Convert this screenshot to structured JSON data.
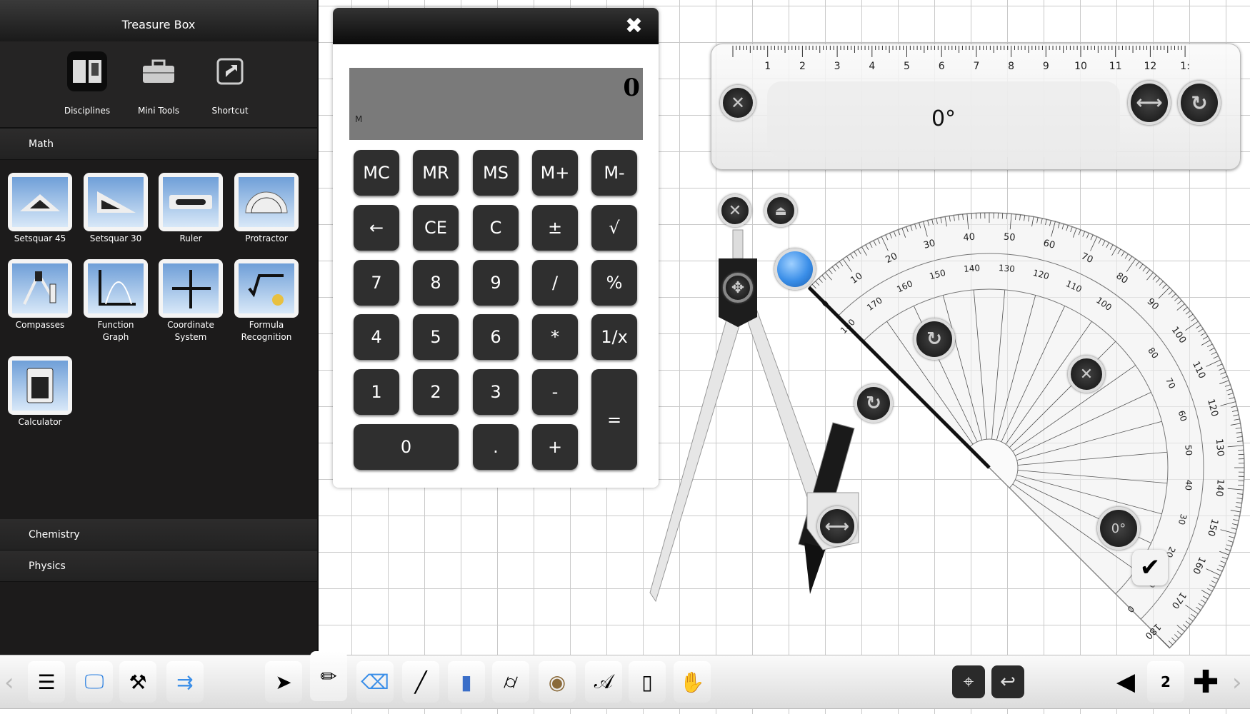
{
  "sidebar": {
    "title": "Treasure Box",
    "top_items": [
      {
        "label": "Disciplines",
        "icon": "book-icon"
      },
      {
        "label": "Mini Tools",
        "icon": "toolbox-icon"
      },
      {
        "label": "Shortcut",
        "icon": "shortcut-icon"
      }
    ],
    "sections": {
      "math": "Math",
      "chemistry": "Chemistry",
      "physics": "Physics"
    },
    "tools": [
      {
        "label": "Setsquar 45"
      },
      {
        "label": "Setsquar 30"
      },
      {
        "label": "Ruler"
      },
      {
        "label": "Protractor"
      },
      {
        "label": "Compasses"
      },
      {
        "label": "Function Graph"
      },
      {
        "label": "Coordinate System"
      },
      {
        "label": "Formula Recognition"
      },
      {
        "label": "Calculator"
      }
    ]
  },
  "calculator": {
    "display_value": "0",
    "memory_indicator": "M",
    "keys": [
      "MC",
      "MR",
      "MS",
      "M+",
      "M-",
      "←",
      "CE",
      "C",
      "±",
      "√",
      "7",
      "8",
      "9",
      "/",
      "%",
      "4",
      "5",
      "6",
      "*",
      "1/x",
      "1",
      "2",
      "3",
      "-",
      "=",
      "0",
      ".",
      "+"
    ]
  },
  "ruler": {
    "angle": "0°",
    "scale_labels": [
      "1",
      "2",
      "3",
      "4",
      "5",
      "6",
      "7",
      "8",
      "9",
      "10",
      "11",
      "12",
      "1:"
    ]
  },
  "protractor": {
    "angle": "0°",
    "outer_labels": [
      "0",
      "10",
      "20",
      "30",
      "40",
      "50",
      "60",
      "70",
      "80",
      "90",
      "100",
      "110",
      "120",
      "130",
      "140",
      "150",
      "160",
      "170",
      "180"
    ],
    "inner_labels": [
      "180",
      "170",
      "160",
      "150",
      "140",
      "130",
      "120",
      "110",
      "100",
      "80",
      "70",
      "60",
      "50",
      "40",
      "30",
      "20",
      "10",
      "0"
    ]
  },
  "toolbar": {
    "page_number": "2"
  },
  "colors": {
    "sidebar_bg": "#1c1b1b",
    "calc_key": "#2f2f2f",
    "calc_display": "#7a7a7a",
    "handle_blue": "#3a8ee8"
  }
}
